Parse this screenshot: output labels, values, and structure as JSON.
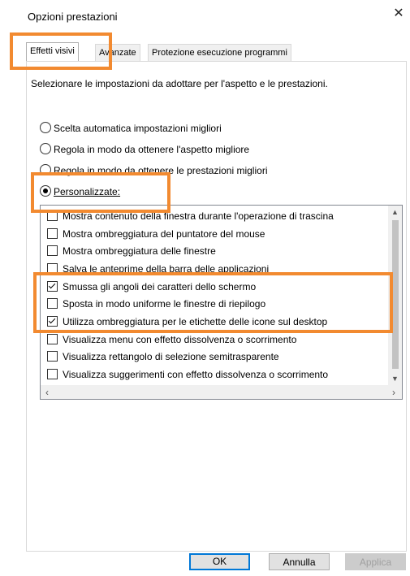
{
  "window": {
    "title": "Opzioni prestazioni",
    "close_glyph": "✕"
  },
  "tabs": [
    {
      "label": "Effetti visivi",
      "active": true
    },
    {
      "label": "Avanzate",
      "active": false
    },
    {
      "label": "Protezione esecuzione programmi",
      "active": false
    }
  ],
  "intro": "Selezionare le impostazioni da adottare per l'aspetto e le prestazioni.",
  "radios": [
    {
      "label": "Scelta automatica impostazioni migliori",
      "checked": false
    },
    {
      "label": "Regola in modo da ottenere l'aspetto migliore",
      "checked": false
    },
    {
      "label": "Regola in modo da ottenere le prestazioni migliori",
      "checked": false
    },
    {
      "label": "Personalizzate:",
      "checked": true
    }
  ],
  "options": [
    {
      "label": "Mostra contenuto della finestra durante l'operazione di trascina",
      "checked": false
    },
    {
      "label": "Mostra ombreggiatura del puntatore del mouse",
      "checked": false
    },
    {
      "label": "Mostra ombreggiatura delle finestre",
      "checked": false
    },
    {
      "label": "Salva le anteprime della barra delle applicazioni",
      "checked": false
    },
    {
      "label": "Smussa gli angoli dei caratteri dello schermo",
      "checked": true
    },
    {
      "label": "Sposta in modo uniforme le finestre di riepilogo",
      "checked": false
    },
    {
      "label": "Utilizza ombreggiatura per le etichette delle icone sul desktop",
      "checked": true
    },
    {
      "label": "Visualizza menu con effetto dissolvenza o scorrimento",
      "checked": false
    },
    {
      "label": "Visualizza rettangolo di selezione semitrasparente",
      "checked": false
    },
    {
      "label": "Visualizza suggerimenti con effetto dissolvenza o scorrimento",
      "checked": false
    }
  ],
  "buttons": {
    "ok": "OK",
    "cancel": "Annulla",
    "apply": "Applica"
  },
  "highlight_color": "#f28a30"
}
